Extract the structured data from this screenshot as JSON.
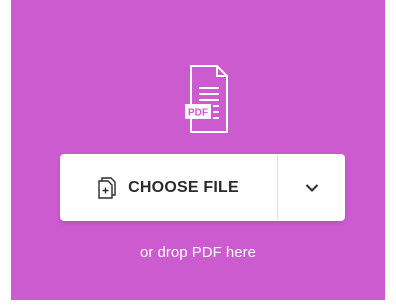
{
  "colors": {
    "panel_bg": "#cc5bd0",
    "button_bg": "#ffffff",
    "button_text": "#2b2b2b",
    "drop_text": "#ffffff"
  },
  "icons": {
    "hero": "pdf-file-icon",
    "choose": "file-add-icon",
    "dropdown": "chevron-down-icon"
  },
  "hero": {
    "badge": "PDF"
  },
  "upload": {
    "choose_label": "CHOOSE FILE",
    "drop_hint": "or drop PDF here"
  }
}
